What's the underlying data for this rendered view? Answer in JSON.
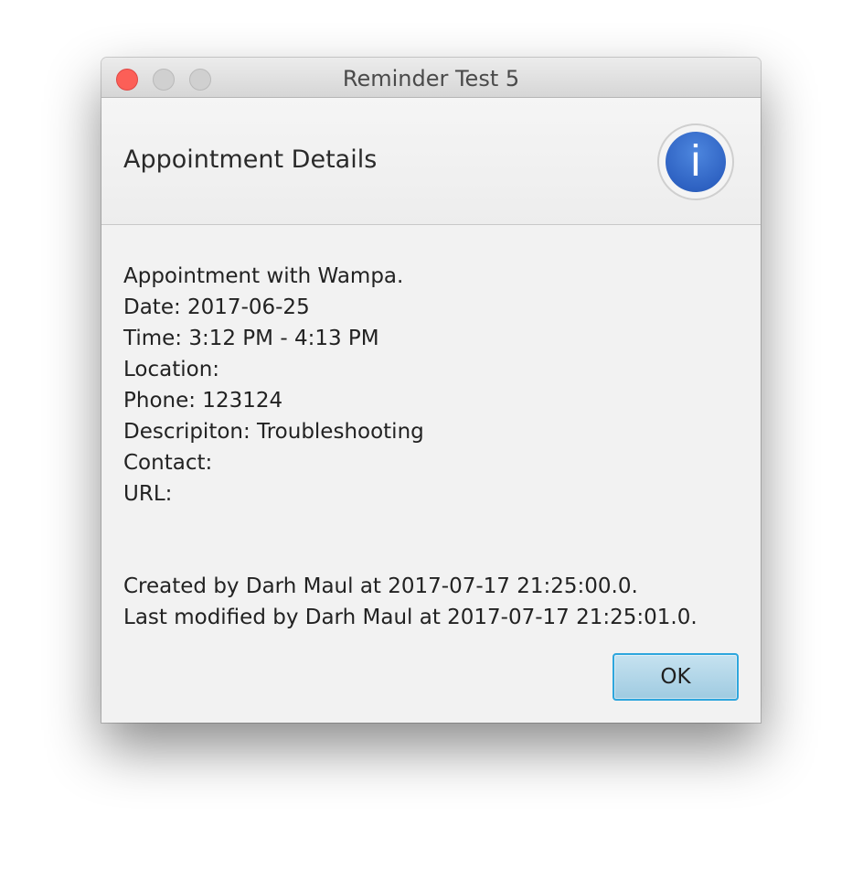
{
  "window": {
    "title": "Reminder Test 5"
  },
  "header": {
    "title": "Appointment Details",
    "icon": "info-icon",
    "icon_glyph": "i",
    "icon_color": "#2f63c3"
  },
  "details": {
    "lines": [
      "Appointment with Wampa.",
      "Date: 2017-06-25",
      "Time: 3:12 PM - 4:13 PM",
      "Location:",
      "Phone: 123124",
      "Descripiton: Troubleshooting",
      "Contact:",
      "URL:"
    ],
    "audit": [
      "Created by Darh Maul at 2017-07-17 21:25:00.0.",
      "Last modified by Darh Maul at 2017-07-17 21:25:01.0."
    ]
  },
  "buttons": {
    "ok_label": "OK"
  },
  "colors": {
    "close_button": "#fc5f57",
    "focus_ring": "#2ea6dd"
  }
}
